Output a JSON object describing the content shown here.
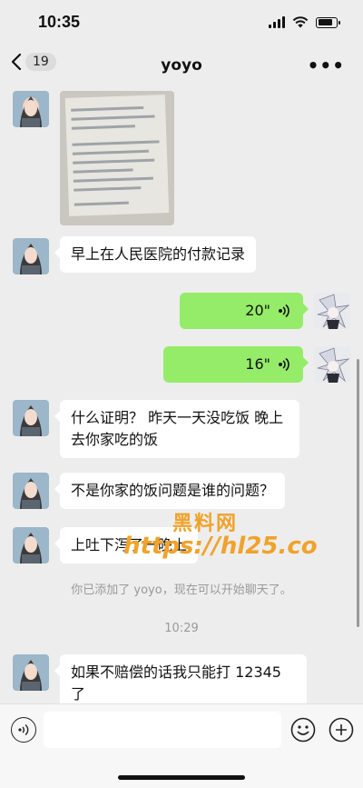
{
  "status_bar": {
    "time": "10:35",
    "battery_level": 0.85
  },
  "nav": {
    "back_count": "19",
    "title": "yoyo",
    "more": "•••"
  },
  "messages": {
    "m1_text": "早上在人民医院的付款记录",
    "v1_duration": "20\"",
    "v2_duration": "16\"",
    "m2_text": "什么证明？ 昨天一天没吃饭 晚上去你家吃的饭",
    "m3_text": "不是你家的饭问题是谁的问题？",
    "m4_text": "上吐下泻了一晚上",
    "system_text": "你已添加了 yoyo，现在可以开始聊天了。",
    "timestamp": "10:29",
    "m5_text": "如果不赔偿的话我只能打 12345 了"
  },
  "watermark": {
    "title": "黑料网",
    "url": "https://hl25.co"
  },
  "input_bar": {
    "placeholder": ""
  },
  "icons": {
    "back": "chevron-left-icon",
    "voice": "voice-icon",
    "emoji": "emoji-icon",
    "plus": "plus-icon"
  }
}
